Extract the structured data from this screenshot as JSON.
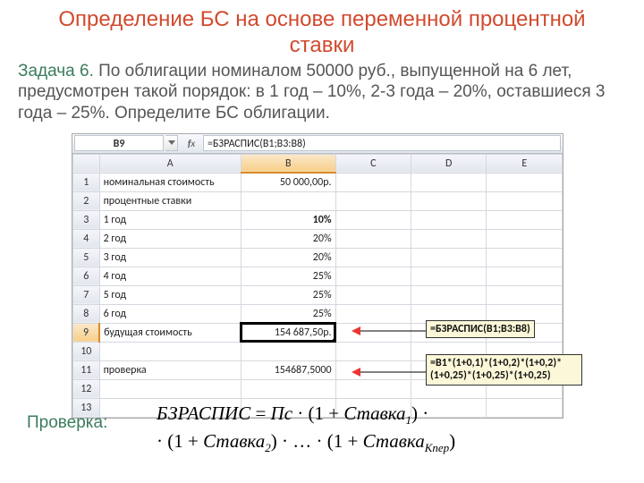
{
  "title": "Определение БС на основе переменной процентной ставки",
  "task_label": "Задача 6.",
  "problem_text": " По облигации номиналом 50000 руб., выпущенной на 6 лет, предусмотрен такой порядок: в 1 год – 10%, 2-3 года – 20%, оставшиеся 3 года – 25%. Определите БС облигации.",
  "sheet": {
    "namebox": "B9",
    "formula": "=БЗРАСПИС(B1;B3:B8)",
    "col_headers": [
      "A",
      "B",
      "C",
      "D",
      "E"
    ],
    "rows": [
      {
        "n": "1",
        "a": "номинальная стоимость",
        "b": "50 000,00р."
      },
      {
        "n": "2",
        "a": "процентные ставки",
        "b": ""
      },
      {
        "n": "3",
        "a": "1 год",
        "b": "10%",
        "bold": true
      },
      {
        "n": "4",
        "a": "2 год",
        "b": "20%"
      },
      {
        "n": "5",
        "a": "3 год",
        "b": "20%"
      },
      {
        "n": "6",
        "a": "4 год",
        "b": "25%"
      },
      {
        "n": "7",
        "a": "5 год",
        "b": "25%"
      },
      {
        "n": "8",
        "a": "6 год",
        "b": "25%"
      },
      {
        "n": "9",
        "a": "будущая стоимость",
        "b": "154 687,50р.",
        "sel": true
      },
      {
        "n": "10",
        "a": "",
        "b": ""
      },
      {
        "n": "11",
        "a": "проверка",
        "b": "154687,5000"
      },
      {
        "n": "12",
        "a": "",
        "b": ""
      },
      {
        "n": "13",
        "a": "",
        "b": ""
      }
    ]
  },
  "callouts": {
    "c1": "=БЗРАСПИС(B1;B3:B8)",
    "c2": "=B1*(1+0,1)*(1+0,2)*(1+0,2)*(1+0,25)*(1+0,25)*(1+0,25)"
  },
  "check_label": "Проверка:",
  "formula": {
    "lhs": "БЗРАСПИС",
    "eq": " = ",
    "pc": "Пс",
    "rate": "Ставка",
    "kper": "Кпер"
  }
}
